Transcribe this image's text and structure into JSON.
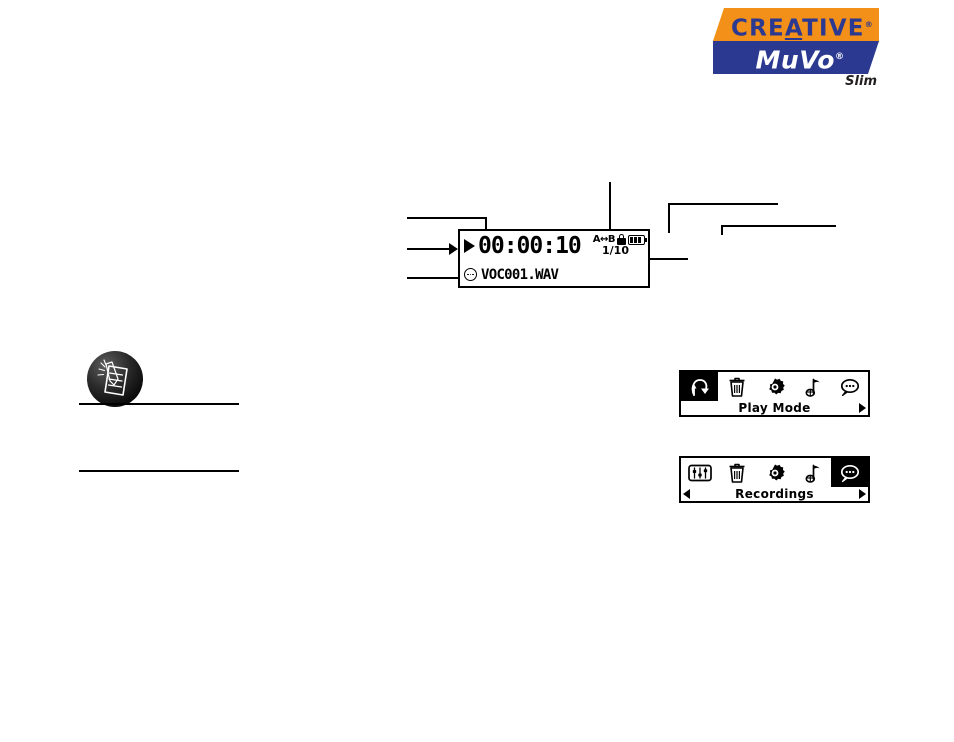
{
  "logo": {
    "brand": "CREATIVE",
    "brand_registered": "®",
    "product": "MuVo",
    "product_registered": "®",
    "variant": "Slim",
    "colors": {
      "orange": "#F39019",
      "blue": "#2B3990",
      "white": "#FFFFFF",
      "dark": "#231F20"
    }
  },
  "lcd": {
    "play_indicator": "play-triangle",
    "time": "00:00:10",
    "track_position": "1/10",
    "file_name": "VOC001.WAV",
    "status_icons": {
      "ab_repeat": "A↔B",
      "lock": "lock-icon",
      "battery": "battery-icon",
      "battery_bars": 3,
      "voice_file": "voice-file-icon"
    }
  },
  "menus": [
    {
      "label": "Play Mode",
      "selected_index": 0,
      "has_left_arrow": false,
      "has_right_arrow": true,
      "icons": [
        {
          "name": "play-mode-loop-icon",
          "label": "Play Mode"
        },
        {
          "name": "delete-trash-icon",
          "label": "Delete"
        },
        {
          "name": "settings-gear-icon",
          "label": "Settings"
        },
        {
          "name": "music-note-flag-icon",
          "label": "Music"
        },
        {
          "name": "recordings-speech-bubble-icon",
          "label": "Recordings"
        }
      ]
    },
    {
      "label": "Recordings",
      "selected_index": 4,
      "has_left_arrow": true,
      "has_right_arrow": true,
      "icons": [
        {
          "name": "equalizer-sliders-icon",
          "label": "Equalizer"
        },
        {
          "name": "delete-trash-icon",
          "label": "Delete"
        },
        {
          "name": "settings-gear-icon",
          "label": "Settings"
        },
        {
          "name": "music-note-flag-icon",
          "label": "Music"
        },
        {
          "name": "recordings-speech-bubble-icon",
          "label": "Recordings"
        }
      ]
    }
  ],
  "note_block": {
    "icon": "note-tip-notepad-icon",
    "rules": 2
  }
}
